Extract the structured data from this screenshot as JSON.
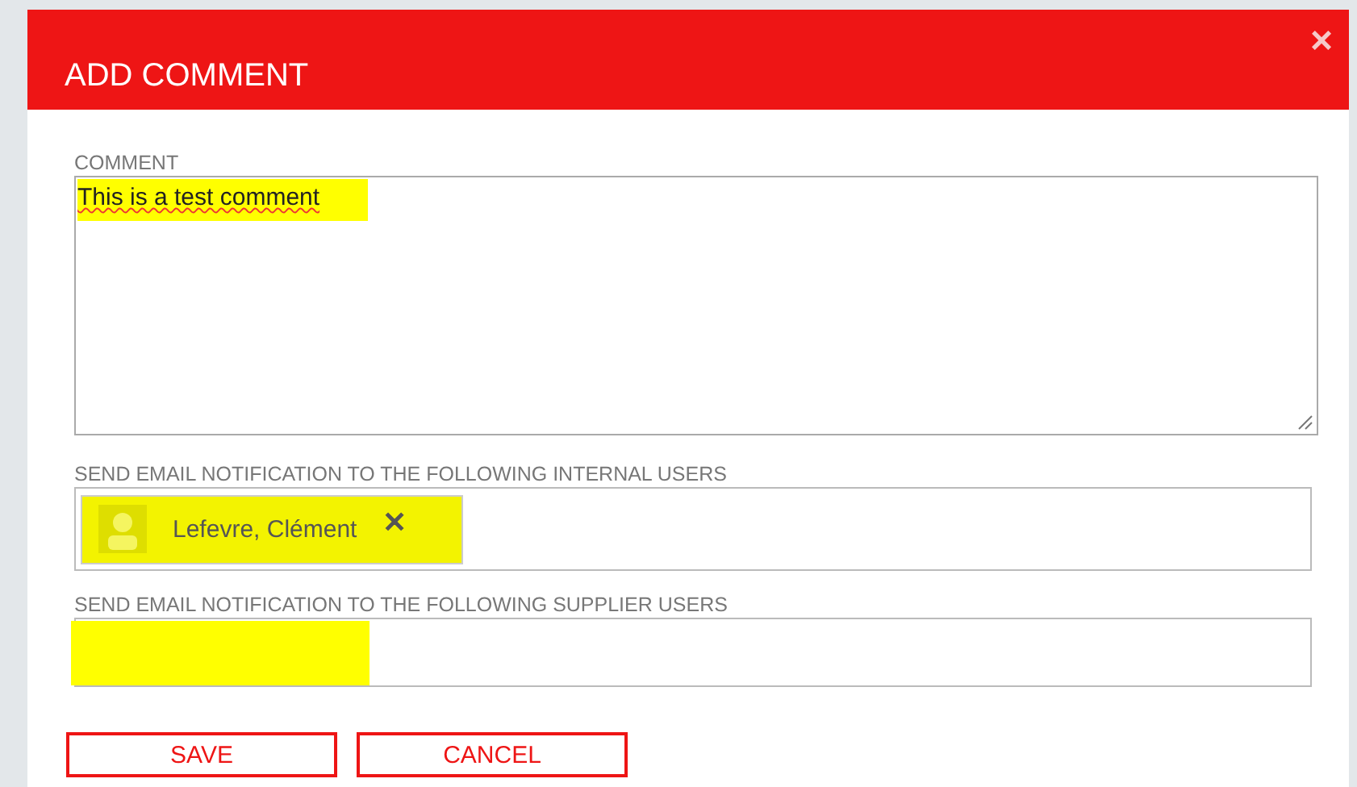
{
  "dialog": {
    "title": "ADD COMMENT",
    "close": "×"
  },
  "comment": {
    "label": "COMMENT",
    "value": "This is a test comment"
  },
  "internal_users": {
    "label": "SEND EMAIL NOTIFICATION TO THE FOLLOWING INTERNAL USERS",
    "chips": [
      {
        "name": "Lefevre, Clément",
        "remove": "✕"
      }
    ]
  },
  "supplier_users": {
    "label": "SEND EMAIL NOTIFICATION TO THE FOLLOWING SUPPLIER USERS"
  },
  "buttons": [
    "SAVE",
    "CANCEL"
  ]
}
